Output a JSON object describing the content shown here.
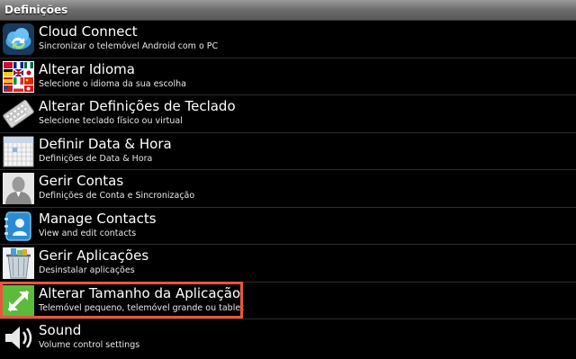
{
  "header": {
    "title": "Definições"
  },
  "settings": {
    "items": [
      {
        "title": "Cloud Connect",
        "subtitle": "Sincronizar o telemóvel Android com o PC",
        "icon": "cloud-sync-icon"
      },
      {
        "title": "Alterar Idioma",
        "subtitle": "Selecione o idioma da sua escolha",
        "icon": "language-flags-icon"
      },
      {
        "title": "Alterar Definições de Teclado",
        "subtitle": "Selecione teclado físico ou virtual",
        "icon": "keyboard-icon"
      },
      {
        "title": "Definir Data & Hora",
        "subtitle": "Definições de Data & Hora",
        "icon": "calendar-icon"
      },
      {
        "title": "Gerir Contas",
        "subtitle": "Definições de Conta e Sincronização",
        "icon": "account-person-icon"
      },
      {
        "title": "Manage Contacts",
        "subtitle": "View and edit contacts",
        "icon": "contacts-icon"
      },
      {
        "title": "Gerir Aplicações",
        "subtitle": "Desinstalar aplicações",
        "icon": "trash-bin-icon"
      },
      {
        "title": "Alterar Tamanho da Aplicação",
        "subtitle": "Telemóvel pequeno, telemóvel grande ou tablet",
        "icon": "resize-arrows-icon",
        "highlighted": true
      },
      {
        "title": "Sound",
        "subtitle": "Volume control settings",
        "icon": "speaker-icon"
      }
    ]
  },
  "colors": {
    "highlight_border": "#e8563e",
    "title_bar": "#6c6c6c",
    "background": "#000000"
  }
}
